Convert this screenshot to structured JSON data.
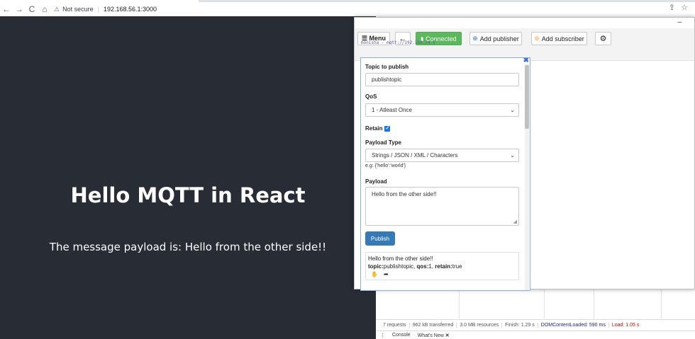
{
  "browser": {
    "back_icon": "←",
    "forward_icon": "→",
    "reload_icon": "C",
    "home_icon": "⌂",
    "security_text": "Not secure",
    "url": "192.168.56.1:3000",
    "share_icon": "⇪",
    "bookmark_icon": "☆"
  },
  "app": {
    "heading": "Hello MQTT in React",
    "payload_text": "The message payload is: Hello from the other side!!"
  },
  "mqtt": {
    "minimize": "–",
    "toolbar": {
      "menu_label": "☰ Menu",
      "back_label": "←",
      "connected_label": "Connected",
      "add_publisher_label": "Add publisher",
      "add_subscriber_label": "Add subscriber",
      "settings_icon": "⚙"
    },
    "connection_label": "monisha - mqtt://192.168.24.5",
    "publisher": {
      "close": "✖",
      "topic_label": "Topic to publish",
      "topic_value": "publishtopic",
      "qos_label": "QoS",
      "qos_value": "1 - Atleast Once",
      "retain_label": "Retain",
      "payload_type_label": "Payload Type",
      "payload_type_value": "Strings / JSON / XML / Characters",
      "payload_hint": "e.g: {'hello':'world'}",
      "payload_label": "Payload",
      "payload_value": "Hello from the other side!!",
      "publish_label": "Publish",
      "message": {
        "text": "Hello from the other side!!",
        "topic_key": "topic:",
        "topic_val": "publishtopic, ",
        "qos_key": "qos:",
        "qos_val": "1, ",
        "retain_key": "retain:",
        "retain_val": "true"
      }
    }
  },
  "devtools": {
    "requests": "7 requests",
    "transferred": "962 kB transferred",
    "resources": "3.0 MB resources",
    "finish": "Finish: 1.29 s",
    "dcl": "DOMContentLoaded: 590 ms",
    "load": "Load: 1.05 s",
    "menu_icon": "⋮",
    "console_tab": "Console",
    "whatsnew_tab": "What's New",
    "close_tab": "✕"
  }
}
